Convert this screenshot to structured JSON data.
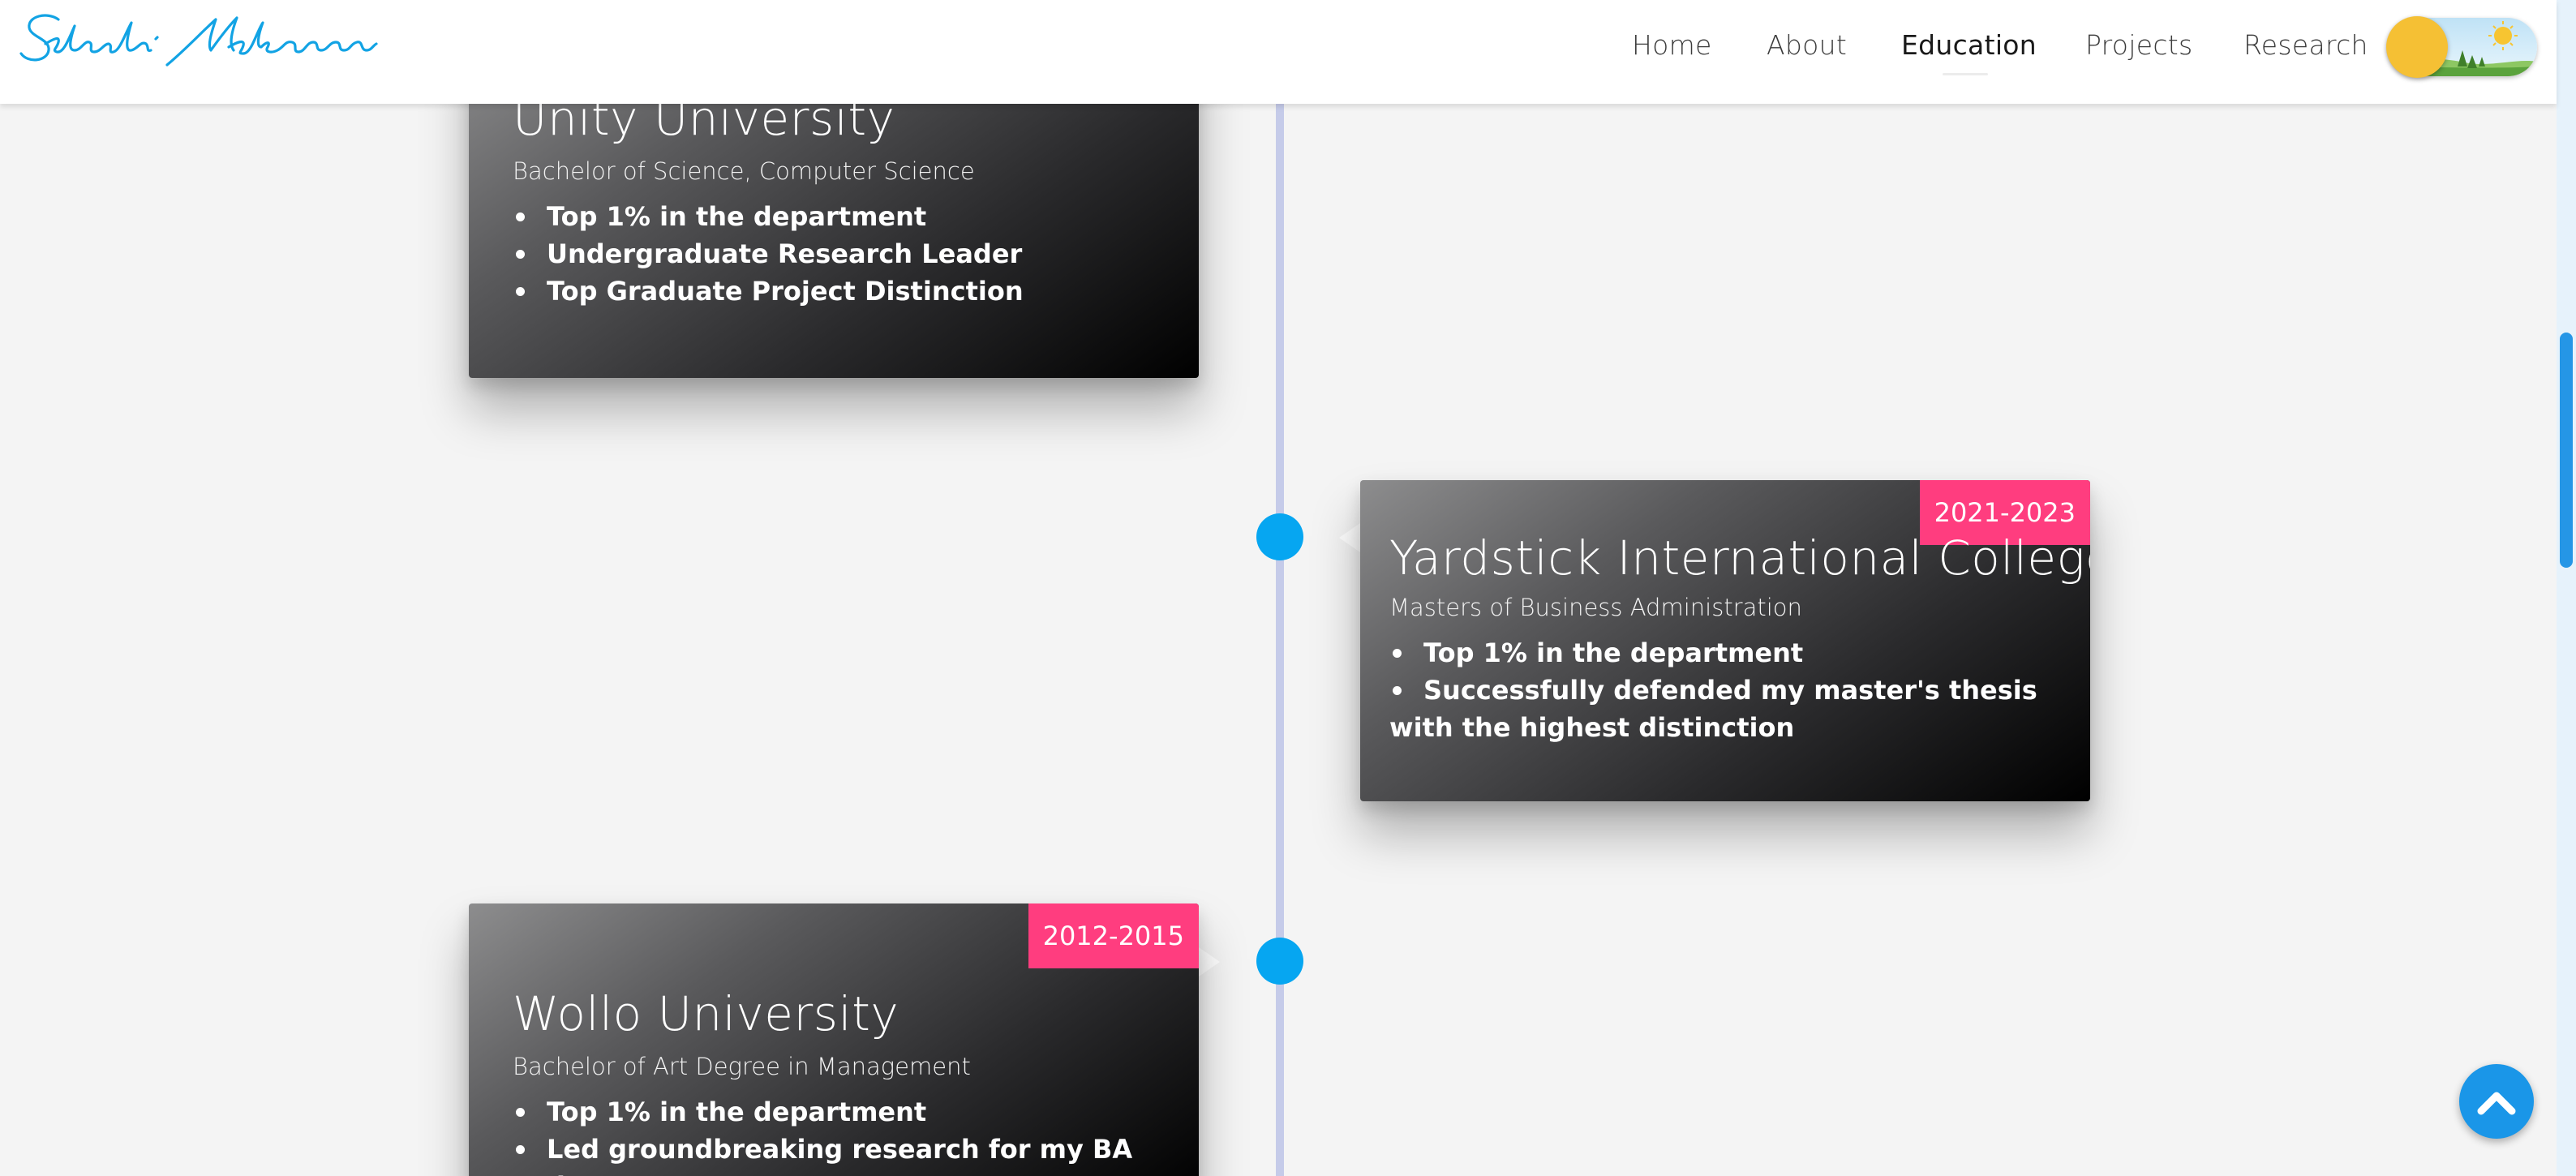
{
  "header": {
    "logo_alt": "Seleshi Mekonnen",
    "nav": [
      {
        "label": "Home"
      },
      {
        "label": "About"
      },
      {
        "label": "Education"
      },
      {
        "label": "Projects"
      },
      {
        "label": "Research"
      }
    ],
    "active_nav": "Education",
    "theme_toggle_state": "light"
  },
  "education": [
    {
      "school": "Unity University",
      "degree": "Bachelor of Science, Computer Science",
      "period": "",
      "highlights": [
        "Top 1% in the department",
        "Undergraduate Research Leader",
        "Top Graduate Project Distinction"
      ]
    },
    {
      "school": "Yardstick International College",
      "degree": "Masters of Business Administration",
      "period": "2021-2023",
      "highlights": [
        "Top 1% in the department",
        "Successfully defended my master's thesis with the highest distinction"
      ]
    },
    {
      "school": "Wollo University",
      "degree": "Bachelor of Art Degree in Management",
      "period": "2012-2015",
      "highlights": [
        "Top 1% in the department",
        "Led groundbreaking research for my BA degreer"
      ]
    }
  ],
  "colors": {
    "accent": "#06a6f1",
    "badge": "#ff3d7f",
    "timeline": "#c5cbe9",
    "logo": "#12a3e4"
  },
  "icons": {
    "scroll_top": "chevron-up-icon",
    "toggle_sun": "sun-icon"
  }
}
